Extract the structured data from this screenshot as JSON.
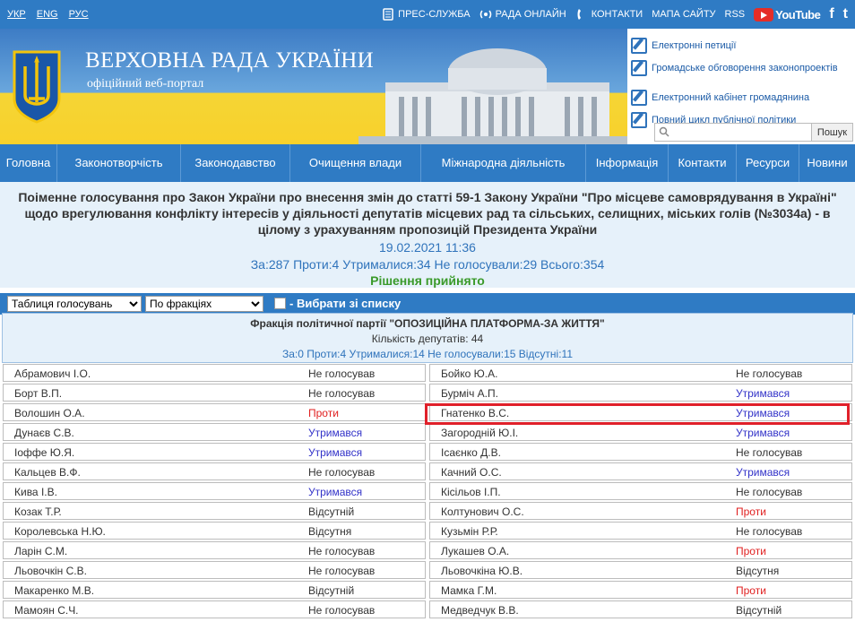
{
  "topbar": {
    "langs": [
      "УКР",
      "ENG",
      "РУС"
    ],
    "links": [
      "ПРЕС-СЛУЖБА",
      "РАДА ОНЛАЙН",
      "КОНТАКТИ",
      "МАПА САЙТУ",
      "RSS"
    ],
    "youtube": "YouTube",
    "facebook": "f",
    "twitter": "t"
  },
  "banner": {
    "title": "ВЕРХОВНА РАДА УКРАЇНИ",
    "subtitle": "офіційний веб-портал",
    "services": [
      "Електронні петиції",
      "Громадське обговорення законопроектів",
      "Електронний кабінет громадянина",
      "Повний цикл публічної політики"
    ],
    "search_placeholder": "",
    "search_button": "Пошук"
  },
  "nav": [
    "Головна",
    "Законотворчість",
    "Законодавство",
    "Очищення влади",
    "Міжнародна діяльність",
    "Інформація",
    "Контакти",
    "Ресурси",
    "Новини"
  ],
  "vote": {
    "title": "Поіменне голосування про Закон України про внесення змін до статті 59-1 Закону України \"Про місцеве самоврядування в Україні\" щодо врегулювання конфлікту інтересів у діяльності депутатів місцевих рад та сільських, селищних, міських голів (№3034а) - в цілому з урахуванням пропозицій Президента України",
    "date": "19.02.2021 11:36",
    "stats": "За:287 Проти:4 Утрималися:34 Не голосували:29 Всього:354",
    "result": "Рішення прийнято"
  },
  "controls": {
    "view_select": "Таблиця голосувань",
    "group_select": "По фракціях",
    "choose_label": "- Вибрати зі списку"
  },
  "faction": {
    "name": "Фракція політичної партії \"ОПОЗИЦІЙНА ПЛАТФОРМА-ЗА ЖИТТЯ\"",
    "count": "Кількість депутатів: 44",
    "stats": "За:0 Проти:4 Утрималися:14 Не голосували:15 Відсутні:11"
  },
  "deputies_left": [
    {
      "name": "Абрамович І.О.",
      "status": "Не голосував",
      "kind": "none"
    },
    {
      "name": "Борт В.П.",
      "status": "Не голосував",
      "kind": "none"
    },
    {
      "name": "Волошин О.А.",
      "status": "Проти",
      "kind": "against"
    },
    {
      "name": "Дунаєв С.В.",
      "status": "Утримався",
      "kind": "abstain"
    },
    {
      "name": "Іоффе Ю.Я.",
      "status": "Утримався",
      "kind": "abstain"
    },
    {
      "name": "Кальцев В.Ф.",
      "status": "Не голосував",
      "kind": "none"
    },
    {
      "name": "Кива І.В.",
      "status": "Утримався",
      "kind": "abstain"
    },
    {
      "name": "Козак Т.Р.",
      "status": "Відсутній",
      "kind": "abs"
    },
    {
      "name": "Королевська Н.Ю.",
      "status": "Відсутня",
      "kind": "abs"
    },
    {
      "name": "Ларін С.М.",
      "status": "Не голосував",
      "kind": "none"
    },
    {
      "name": "Льовочкін С.В.",
      "status": "Не голосував",
      "kind": "none"
    },
    {
      "name": "Макаренко М.В.",
      "status": "Відсутній",
      "kind": "abs"
    },
    {
      "name": "Мамоян С.Ч.",
      "status": "Не голосував",
      "kind": "none"
    }
  ],
  "deputies_right": [
    {
      "name": "Бойко Ю.А.",
      "status": "Не голосував",
      "kind": "none"
    },
    {
      "name": "Бурміч А.П.",
      "status": "Утримався",
      "kind": "abstain"
    },
    {
      "name": "Гнатенко В.С.",
      "status": "Утримався",
      "kind": "abstain"
    },
    {
      "name": "Загородній Ю.І.",
      "status": "Утримався",
      "kind": "abstain"
    },
    {
      "name": "Ісаєнко Д.В.",
      "status": "Не голосував",
      "kind": "none"
    },
    {
      "name": "Качний О.С.",
      "status": "Утримався",
      "kind": "abstain"
    },
    {
      "name": "Кісільов І.П.",
      "status": "Не голосував",
      "kind": "none"
    },
    {
      "name": "Колтунович О.С.",
      "status": "Проти",
      "kind": "against"
    },
    {
      "name": "Кузьмін Р.Р.",
      "status": "Не голосував",
      "kind": "none"
    },
    {
      "name": "Лукашев О.А.",
      "status": "Проти",
      "kind": "against"
    },
    {
      "name": "Льовочкіна Ю.В.",
      "status": "Відсутня",
      "kind": "abs"
    },
    {
      "name": "Мамка Г.М.",
      "status": "Проти",
      "kind": "against"
    },
    {
      "name": "Медведчук В.В.",
      "status": "Відсутній",
      "kind": "abs"
    }
  ]
}
